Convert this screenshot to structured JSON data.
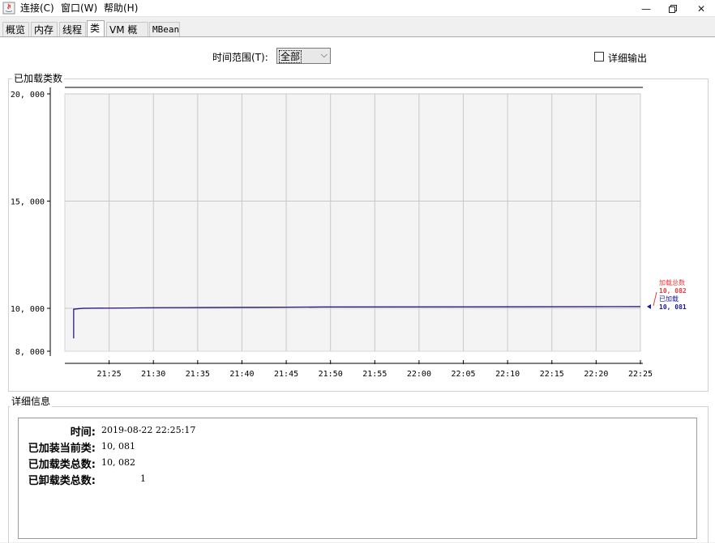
{
  "menubar": {
    "items": [
      "连接(C)",
      "窗口(W)",
      "帮助(H)"
    ]
  },
  "tabs": [
    "概览",
    "内存",
    "线程",
    "类",
    "VM 概要",
    "MBean"
  ],
  "active_tab": "类",
  "controls": {
    "time_range_label": "时间范围(T):",
    "time_range_value": "全部",
    "verbose_label": "详细输出",
    "verbose_checked": false
  },
  "chart_panel": {
    "title": "已加载类数"
  },
  "chart_data": {
    "type": "line",
    "y_ticks": [
      "20, 000",
      "15, 000",
      "10, 000",
      "8, 000"
    ],
    "x_ticks": [
      "21:25",
      "21:30",
      "21:35",
      "21:40",
      "21:45",
      "21:50",
      "21:55",
      "22:00",
      "22:05",
      "22:10",
      "22:15",
      "22:20",
      "22:25"
    ],
    "ylim": [
      8000,
      20000
    ],
    "grid": true,
    "legend_position": "right",
    "series": [
      {
        "name": "加载总数",
        "color": "#e33b3b",
        "last_value": "10, 082",
        "x": [
          "21:21",
          "21:21",
          "21:22",
          "21:31",
          "21:49",
          "22:25"
        ],
        "y": [
          8600,
          9960,
          10000,
          10030,
          10060,
          10082
        ]
      },
      {
        "name": "已加载",
        "color": "#1a1a8c",
        "last_value": "10, 081",
        "x": [
          "21:21",
          "21:21",
          "21:22",
          "21:31",
          "21:49",
          "22:25"
        ],
        "y": [
          8600,
          9960,
          10000,
          10030,
          10060,
          10081
        ]
      }
    ]
  },
  "details_panel": {
    "title": "详细信息",
    "rows": [
      {
        "label": "时间:",
        "value": "2019-08-22 22:25:17"
      },
      {
        "label": "已加装当前类:",
        "value": "10, 081"
      },
      {
        "label": "已加载类总数:",
        "value": "10, 082"
      },
      {
        "label": "已卸载类总数:",
        "value": "1"
      }
    ]
  },
  "window_buttons": {
    "minimize": "—",
    "restore": "🗗",
    "close": "✕"
  }
}
